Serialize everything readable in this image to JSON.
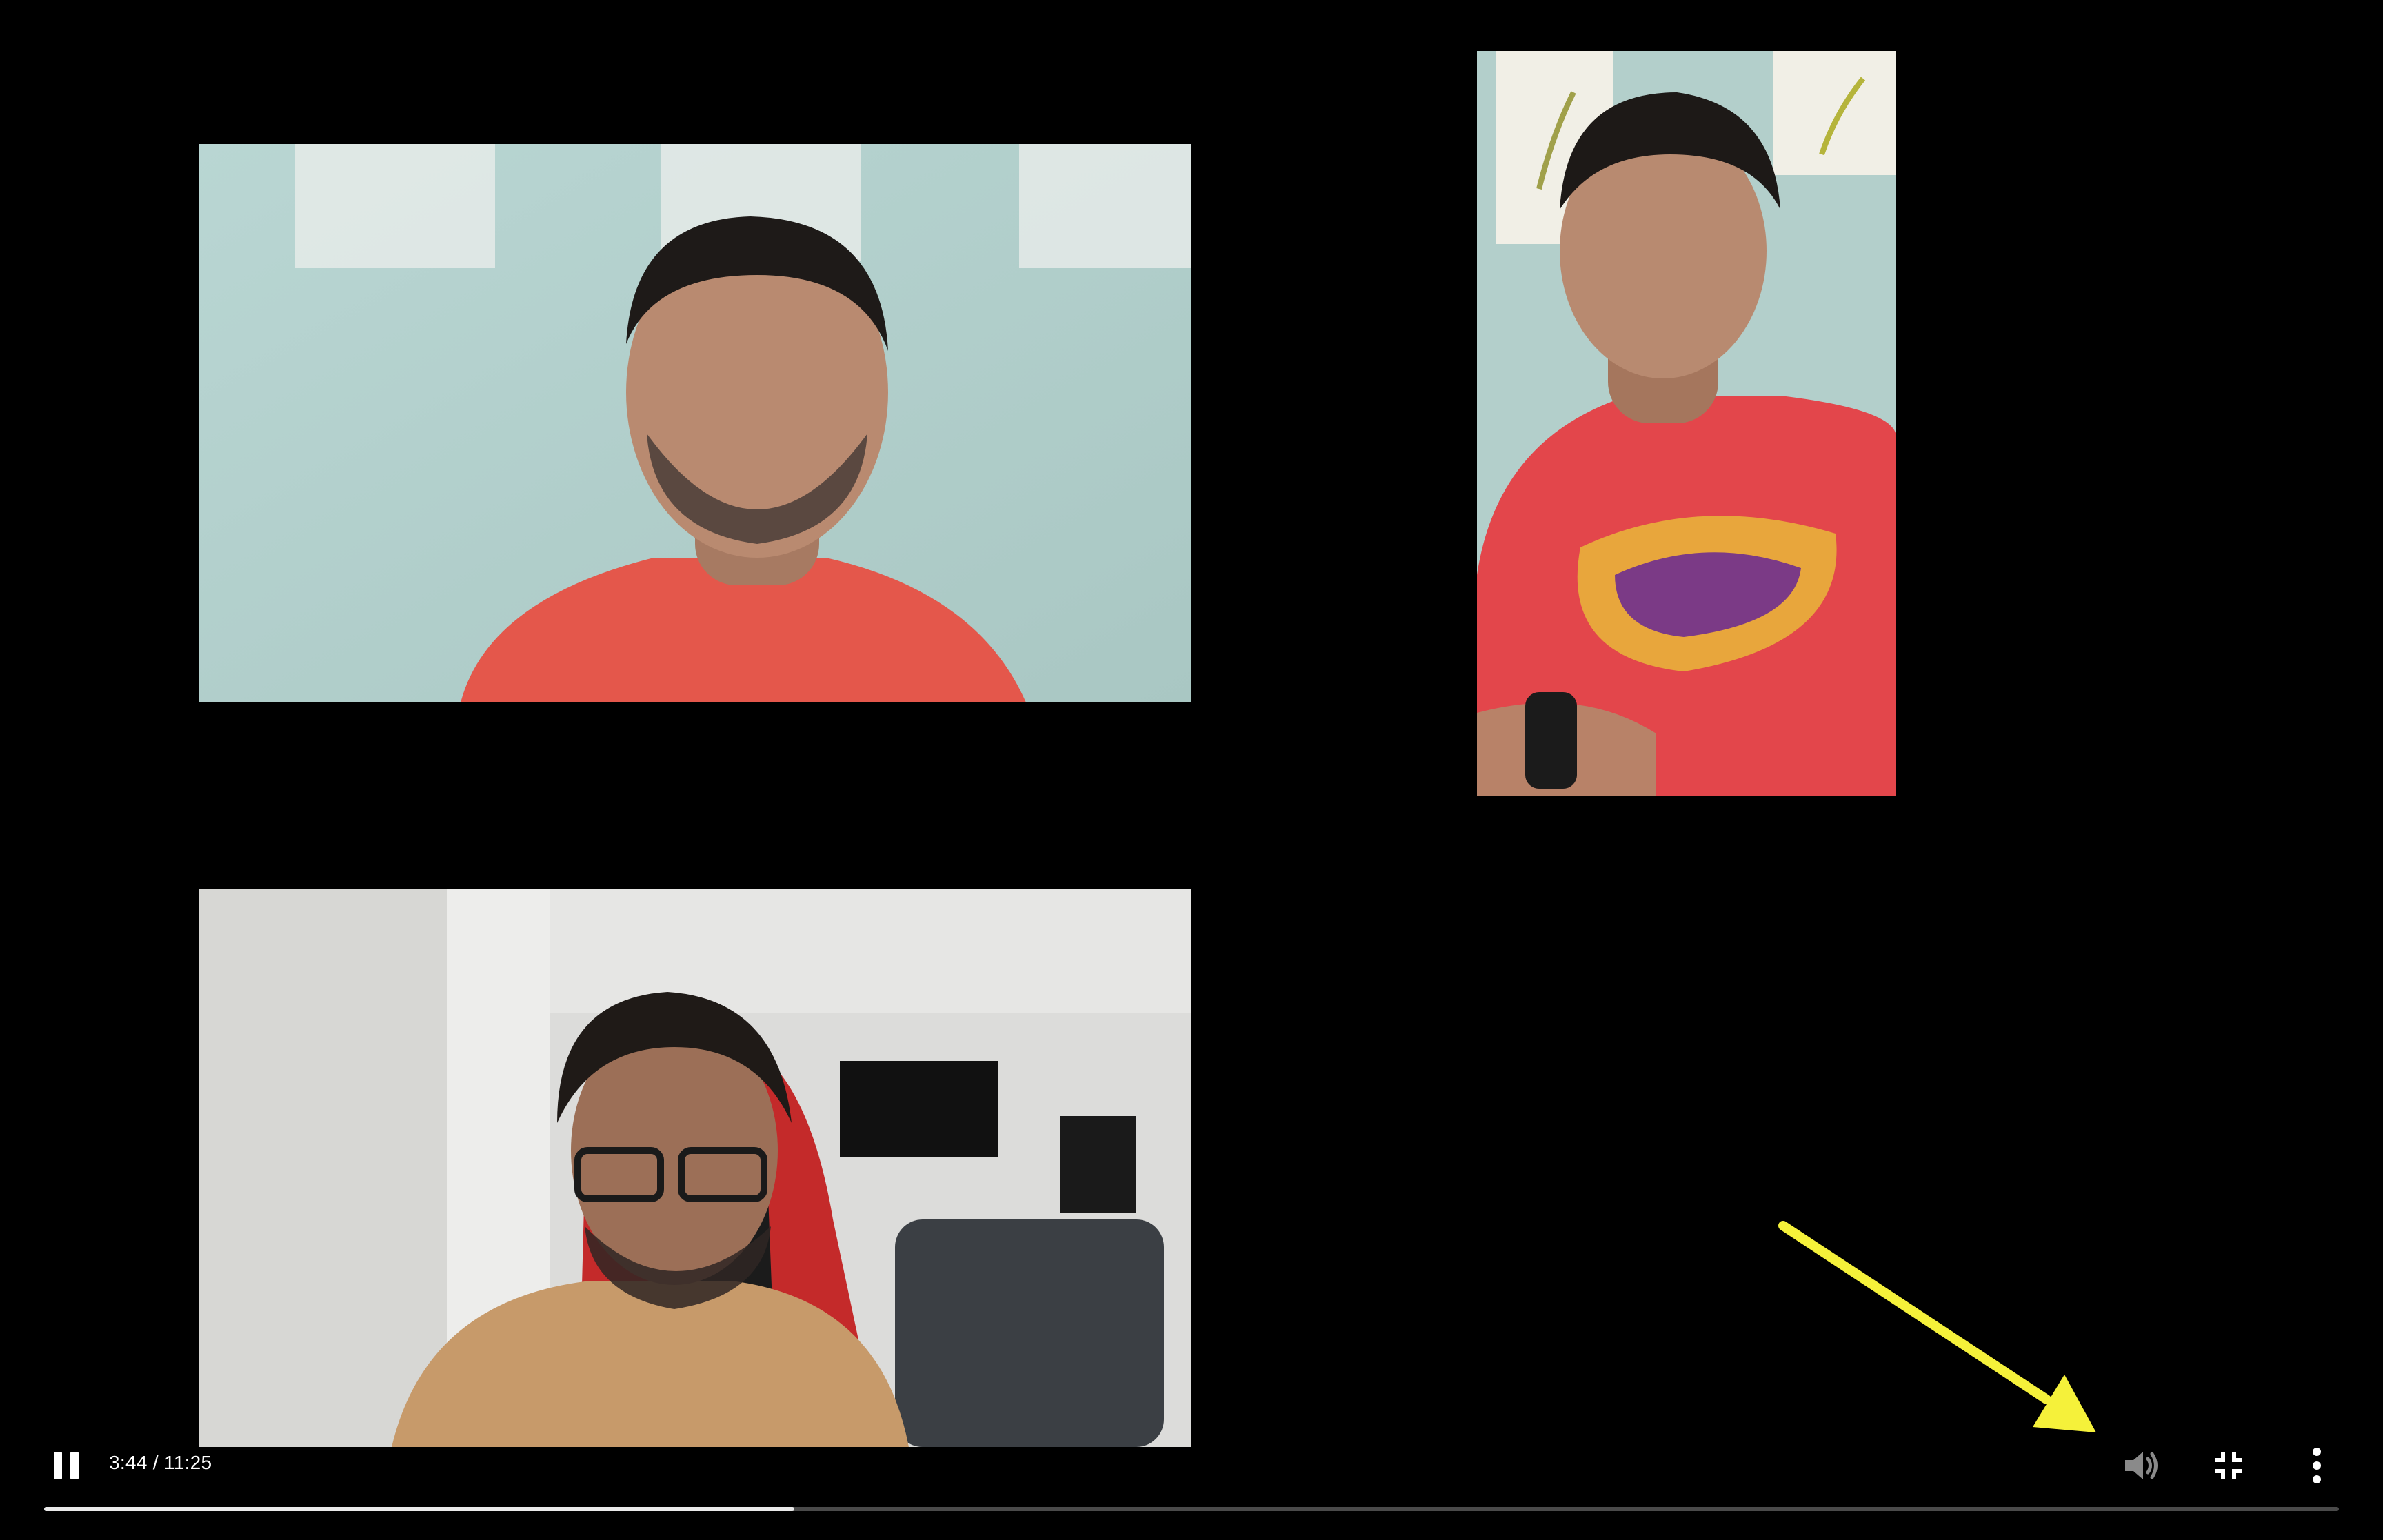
{
  "player": {
    "time_display": "3:44 / 11:25",
    "progress_fraction": 0.327,
    "state": "playing"
  },
  "icons": {
    "play_pause": "pause-icon",
    "volume": "volume-icon",
    "fullscreen": "exit-fullscreen-icon",
    "more": "more-vertical-icon"
  },
  "participants": [
    {
      "tile": "top-left"
    },
    {
      "tile": "top-right"
    },
    {
      "tile": "bottom-left"
    }
  ],
  "colors": {
    "background": "#000000",
    "annotation_arrow": "#f5f13a",
    "progress_fill": "#e9e9e9",
    "progress_track": "#4a4a4a"
  }
}
